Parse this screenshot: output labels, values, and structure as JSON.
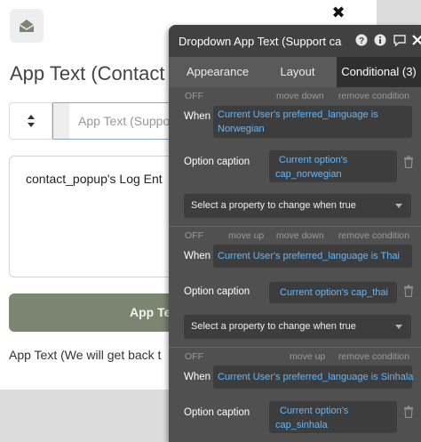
{
  "popup": {
    "close_glyph": "✖",
    "heading": "App Text (Contact",
    "dropdown_value": "App Text (Suppor",
    "textarea_text": "contact_popup's Log Ent",
    "button_label": "App Te",
    "footer_text": "App Text (We will get back t"
  },
  "panel": {
    "title": "Dropdown App Text (Support ca",
    "header_icons": [
      "help-icon",
      "info-icon",
      "comment-icon",
      "close-icon"
    ],
    "tabs": [
      {
        "label": "Appearance"
      },
      {
        "label": "Layout"
      },
      {
        "label": "Conditional (3)"
      }
    ],
    "conditions": [
      {
        "off": "OFF",
        "move_down": "move down",
        "remove": "remove condition",
        "when_label": "When",
        "when_line1": "Current User's preferred_language is",
        "when_line2": "Norwegian",
        "option_label": "Option caption",
        "option_line1": "Current option's",
        "option_line2": "cap_norwegian",
        "select_placeholder": "Select a property to change when true"
      },
      {
        "off": "OFF",
        "move_up": "move up",
        "move_down": "move down",
        "remove": "remove condition",
        "when_label": "When",
        "when_line1": "Current User's preferred_language is Thai",
        "option_label": "Option caption",
        "option_line1": "Current option's cap_thai",
        "select_placeholder": "Select a property to change when true"
      },
      {
        "off": "OFF",
        "move_up": "move up",
        "remove": "remove condition",
        "when_label": "When",
        "when_line1": "Current User's preferred_language is Sinhala",
        "option_label": "Option caption",
        "option_line1": "Current option's",
        "option_line2": "cap_sinhala"
      }
    ]
  },
  "colors": {
    "panel_bg": "#505050",
    "expression_text": "#62b8ff",
    "button_bg": "#7b8572"
  }
}
